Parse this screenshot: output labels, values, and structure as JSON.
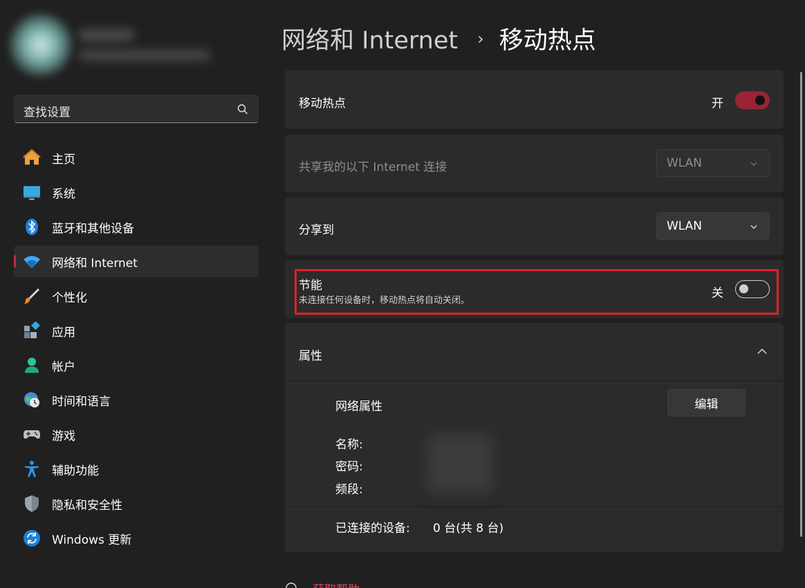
{
  "sidebar": {
    "search_placeholder": "查找设置",
    "items": [
      {
        "label": "主页",
        "icon": "home-icon"
      },
      {
        "label": "系统",
        "icon": "system-icon"
      },
      {
        "label": "蓝牙和其他设备",
        "icon": "bluetooth-icon"
      },
      {
        "label": "网络和 Internet",
        "icon": "wifi-icon",
        "active": true
      },
      {
        "label": "个性化",
        "icon": "brush-icon"
      },
      {
        "label": "应用",
        "icon": "apps-icon"
      },
      {
        "label": "帐户",
        "icon": "account-icon"
      },
      {
        "label": "时间和语言",
        "icon": "time-language-icon"
      },
      {
        "label": "游戏",
        "icon": "gamepad-icon"
      },
      {
        "label": "辅助功能",
        "icon": "accessibility-icon"
      },
      {
        "label": "隐私和安全性",
        "icon": "shield-icon"
      },
      {
        "label": "Windows 更新",
        "icon": "update-icon"
      }
    ]
  },
  "header": {
    "parent": "网络和 Internet",
    "separator": "›",
    "current": "移动热点"
  },
  "hotspot": {
    "label": "移动热点",
    "state": "开"
  },
  "share_from": {
    "label": "共享我的以下 Internet 连接",
    "value": "WLAN"
  },
  "share_to": {
    "label": "分享到",
    "value": "WLAN"
  },
  "power_saving": {
    "label": "节能",
    "description": "未连接任何设备时，移动热点将自动关闭。",
    "state": "关"
  },
  "properties": {
    "label": "属性",
    "network_properties": "网络属性",
    "edit_label": "编辑",
    "name_label": "名称:",
    "password_label": "密码:",
    "band_label": "频段:",
    "connected_label": "已连接的设备:",
    "connected_value": "0 台(共 8 台)"
  },
  "help": {
    "label": "获取帮助"
  },
  "colors": {
    "accent": "#9b2335",
    "highlight": "#e0202e",
    "background": "#202020",
    "card": "#2b2b2b"
  }
}
